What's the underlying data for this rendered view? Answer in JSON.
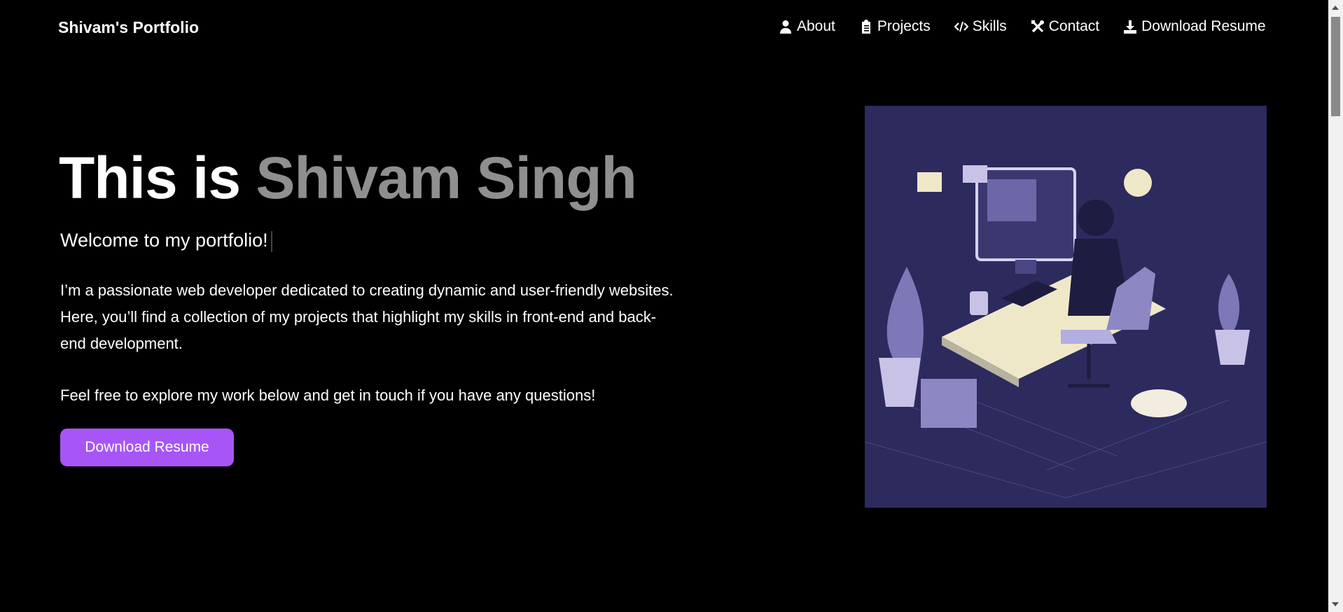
{
  "header": {
    "logo": "Shivam's Portfolio",
    "nav": [
      {
        "label": "About",
        "icon": "user-icon"
      },
      {
        "label": "Projects",
        "icon": "clipboard-icon"
      },
      {
        "label": "Skills",
        "icon": "code-icon"
      },
      {
        "label": "Contact",
        "icon": "tools-icon"
      },
      {
        "label": "Download Resume",
        "icon": "download-icon"
      }
    ]
  },
  "hero": {
    "title_prefix": "This is ",
    "title_name": "Shivam Singh",
    "welcome": "Welcome to my portfolio!",
    "paragraph1": "I’m a passionate web developer dedicated to creating dynamic and user-friendly websites. Here, you’ll find a collection of my projects that highlight my skills in front-end and back-end development.",
    "paragraph2": "Feel free to explore my work below and get in touch if you have any questions!",
    "button_label": "Download Resume",
    "accent": "#a855f7"
  }
}
